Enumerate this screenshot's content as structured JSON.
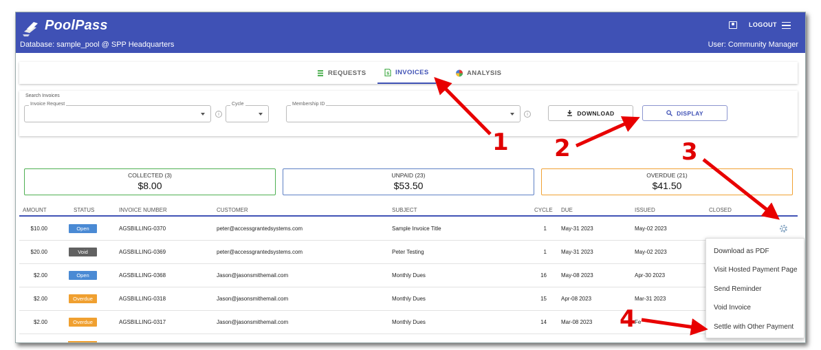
{
  "app": {
    "brand": "PoolPass",
    "database": "Database: sample_pool @ SPP Headquarters",
    "user": "User: Community Manager",
    "logout_label": "LOGOUT",
    "accent": "#3f51b5"
  },
  "tabs": [
    {
      "label": "REQUESTS",
      "icon": "requests-icon"
    },
    {
      "label": "INVOICES",
      "icon": "invoice-icon",
      "active": true
    },
    {
      "label": "ANALYSIS",
      "icon": "pie-chart-icon"
    }
  ],
  "search": {
    "title": "Search Invoices",
    "invoice_request_label": "Invoice Request",
    "cycle_label": "Cycle",
    "membership_label": "Membership ID",
    "download_label": "DOWNLOAD",
    "display_label": "DISPLAY"
  },
  "summary": {
    "collected": {
      "label": "COLLECTED (3)",
      "value": "$8.00",
      "color": "#4caf50"
    },
    "unpaid": {
      "label": "UNPAID (23)",
      "value": "$53.50",
      "color": "#5c7fc4"
    },
    "overdue": {
      "label": "OVERDUE (21)",
      "value": "$41.50",
      "color": "#f0a030"
    }
  },
  "table": {
    "columns": [
      "AMOUNT",
      "STATUS",
      "INVOICE NUMBER",
      "CUSTOMER",
      "SUBJECT",
      "CYCLE",
      "DUE",
      "ISSUED",
      "CLOSED"
    ],
    "rows": [
      {
        "amount": "$10.00",
        "status": "Open",
        "number": "AGSBILLING-0370",
        "customer": "peter@accessgrantedsystems.com",
        "subject": "Sample Invoice Title",
        "cycle": "1",
        "due": "May-31 2023",
        "issued": "May-02 2023"
      },
      {
        "amount": "$20.00",
        "status": "Void",
        "number": "AGSBILLING-0369",
        "customer": "peter@accessgrantedsystems.com",
        "subject": "Peter Testing",
        "cycle": "1",
        "due": "May-31 2023",
        "issued": "May-02 2023"
      },
      {
        "amount": "$2.00",
        "status": "Open",
        "number": "AGSBILLING-0368",
        "customer": "Jason@jasonsmithemail.com",
        "subject": "Monthly Dues",
        "cycle": "16",
        "due": "May-08 2023",
        "issued": "Apr-30 2023"
      },
      {
        "amount": "$2.00",
        "status": "Overdue",
        "number": "AGSBILLING-0318",
        "customer": "Jason@jasonsmithemail.com",
        "subject": "Monthly Dues",
        "cycle": "15",
        "due": "Apr-08 2023",
        "issued": "Mar-31 2023"
      },
      {
        "amount": "$2.00",
        "status": "Overdue",
        "number": "AGSBILLING-0317",
        "customer": "Jason@jasonsmithemail.com",
        "subject": "Monthly Dues",
        "cycle": "14",
        "due": "Mar-08 2023",
        "issued": "Fe"
      }
    ],
    "status_colors": {
      "Open": "#4a8ad4",
      "Void": "#616161",
      "Overdue": "#f0a030"
    }
  },
  "row_menu": {
    "items": [
      "Download as PDF",
      "Visit Hosted Payment Page",
      "Send Reminder",
      "Void Invoice",
      "Settle with Other Payment"
    ]
  },
  "callouts": [
    "1",
    "2",
    "3",
    "4"
  ]
}
